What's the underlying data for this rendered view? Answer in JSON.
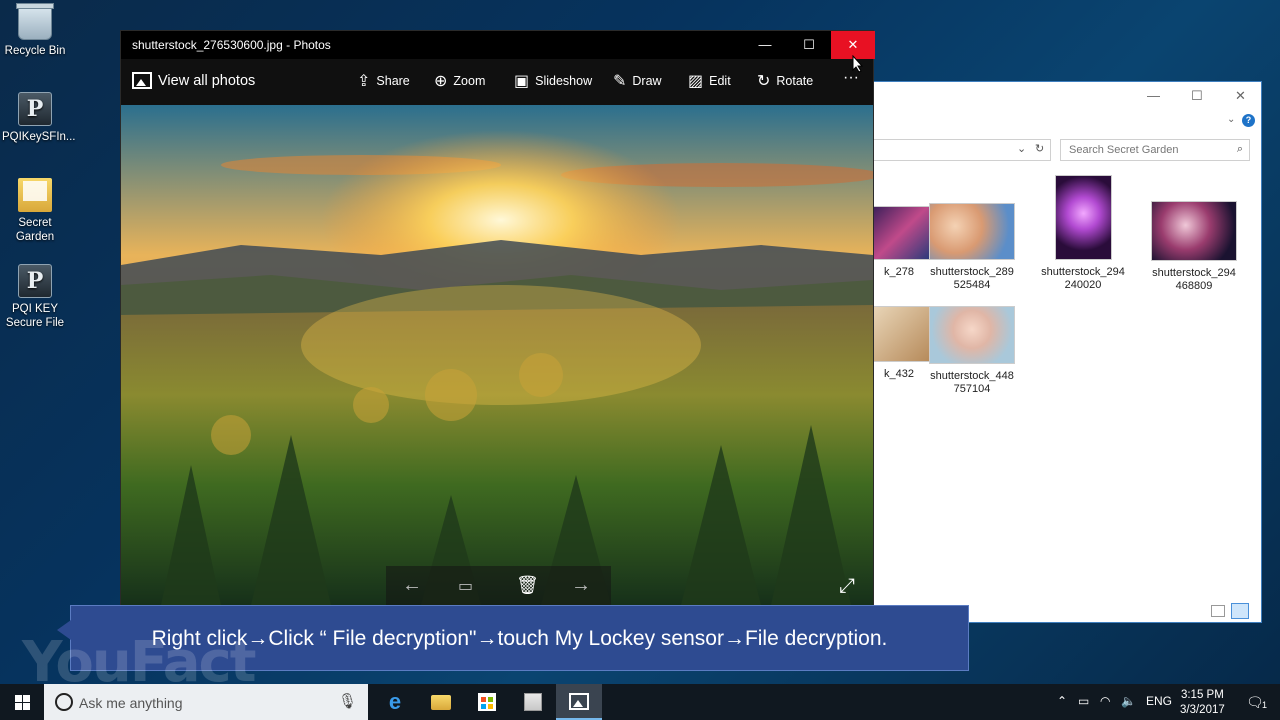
{
  "desktop": {
    "icons": [
      {
        "label": "Recycle Bin",
        "icon": "recycle-bin-icon"
      },
      {
        "label": "PQIKeySFIn...",
        "icon": "pqi-app-icon"
      },
      {
        "label": "Secret\nGarden",
        "icon": "folder-icon"
      },
      {
        "label": "PQI KEY\nSecure File",
        "icon": "pqi-app-icon"
      }
    ]
  },
  "explorer": {
    "minimize": "—",
    "maximize": "☐",
    "close": "✕",
    "search_placeholder": "Search Secret Garden",
    "thumbs": [
      {
        "label": "k_278"
      },
      {
        "label": "shutterstock_289\n525484"
      },
      {
        "label": "shutterstock_294\n240020"
      },
      {
        "label": "shutterstock_294\n468809"
      },
      {
        "label": "k_432"
      },
      {
        "label": "shutterstock_448\n757104"
      }
    ]
  },
  "photos": {
    "title": "shutterstock_276530600.jpg - Photos",
    "view_all": "View all photos",
    "toolbar": {
      "share": "Share",
      "zoom": "Zoom",
      "slideshow": "Slideshow",
      "draw": "Draw",
      "edit": "Edit",
      "rotate": "Rotate",
      "more": "···"
    }
  },
  "caption": "Right click→Click “ File decryption\"→touch My Lockey sensor→File decryption.",
  "watermark": "YouFact",
  "taskbar": {
    "search_placeholder": "Ask me anything",
    "lang": "ENG",
    "time": "3:15 PM",
    "date": "3/3/2017",
    "notifications_count": "1"
  }
}
